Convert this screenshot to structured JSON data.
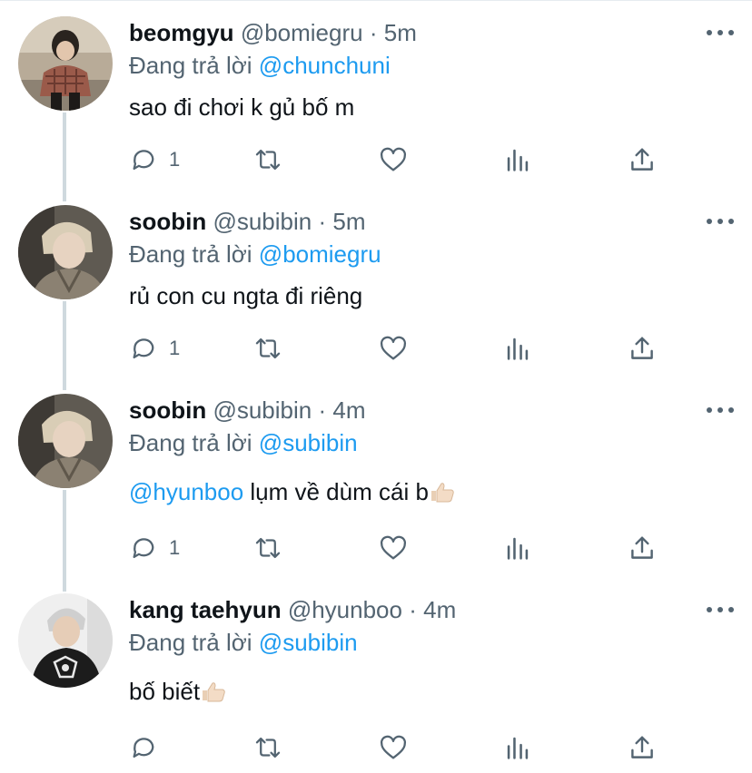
{
  "reply_prefix": "Đang trả lời",
  "tweets": [
    {
      "name": "beomgyu",
      "handle": "@bomiegru",
      "separator": "·",
      "time": "5m",
      "replying_to": "@chunchuni",
      "text": "sao đi chơi k gủ bố m",
      "reply_count": "1",
      "avatar": "avatar-beomgyu"
    },
    {
      "name": "soobin",
      "handle": "@subibin",
      "separator": "·",
      "time": "5m",
      "replying_to": "@bomiegru",
      "text": "rủ con cu ngta đi riêng",
      "reply_count": "1",
      "avatar": "avatar-soobin"
    },
    {
      "name": "soobin",
      "handle": "@subibin",
      "separator": "·",
      "time": "4m",
      "replying_to": "@subibin",
      "text_mention": "@hyunboo",
      "text": " lụm về dùm cái b",
      "reply_count": "1",
      "avatar": "avatar-soobin"
    },
    {
      "name": "kang taehyun",
      "handle": "@hyunboo",
      "separator": "·",
      "time": "4m",
      "replying_to": "@subibin",
      "text": "bố biết",
      "reply_count": "",
      "avatar": "avatar-taehyun"
    }
  ],
  "icons": {
    "reply": "reply-icon",
    "retweet": "retweet-icon",
    "like": "heart-icon",
    "analytics": "analytics-icon",
    "share": "share-icon",
    "more": "more-icon",
    "emoji": "thumbs-up-emoji"
  },
  "colors": {
    "link": "#1d9bf0",
    "secondary_text": "#536471",
    "primary_text": "#0f1419",
    "thread_line": "#cfd9de"
  }
}
